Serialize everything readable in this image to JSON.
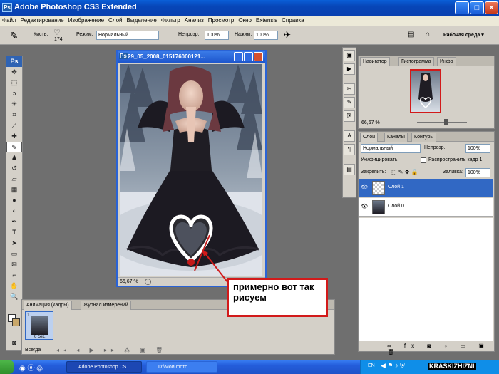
{
  "app": {
    "title": "Adobe Photoshop CS3 Extended",
    "logo": "Ps"
  },
  "menu": [
    "Файл",
    "Редактирование",
    "Изображение",
    "Слой",
    "Выделение",
    "Фильтр",
    "Анализ",
    "Просмотр",
    "Окно",
    "Extensis",
    "Справка"
  ],
  "options": {
    "brush_label": "Кисть:",
    "brush_size": "174",
    "mode_label": "Режим:",
    "mode_value": "Нормальный",
    "opacity_label": "Непрозр.:",
    "opacity_value": "100%",
    "flow_label": "Нажим:",
    "flow_value": "100%",
    "workspace": "Рабочая среда ▾"
  },
  "document": {
    "title": "29_05_2008_015176000121...",
    "zoom": "66,67 %"
  },
  "navigator": {
    "tabs": [
      "Навигатор",
      "Гистограмма",
      "Инфо"
    ],
    "zoom": "66,67 %"
  },
  "layers": {
    "tabs": [
      "Слои",
      "Каналы",
      "Контуры"
    ],
    "mode": "Нормальный",
    "opacity_label": "Непрозр.:",
    "opacity": "100%",
    "unify_label": "Унифицировать:",
    "propagate_label": "Распространить кадр 1",
    "lock_label": "Закрепить:",
    "fill_label": "Заливка:",
    "fill": "100%",
    "items": [
      {
        "name": "Слой 1",
        "selected": true
      },
      {
        "name": "Слой 0",
        "selected": false
      }
    ]
  },
  "animation": {
    "tabs": [
      "Анимация (кадры)",
      "Журнал измерений"
    ],
    "frame_number": "1",
    "frame_delay": "0 сек.",
    "loop": "Всегда"
  },
  "callout": {
    "text": "примерно вот так рисуем"
  },
  "taskbar": {
    "items": [
      "Adobe Photoshop CS...",
      "D:\\Мои фото"
    ],
    "lang": "EN",
    "watermark": "KRASKIZHIZNI"
  },
  "colors": {
    "title_blue": "#0a5fd8",
    "selection": "#3168c4",
    "callout_border": "#d21a1a"
  }
}
